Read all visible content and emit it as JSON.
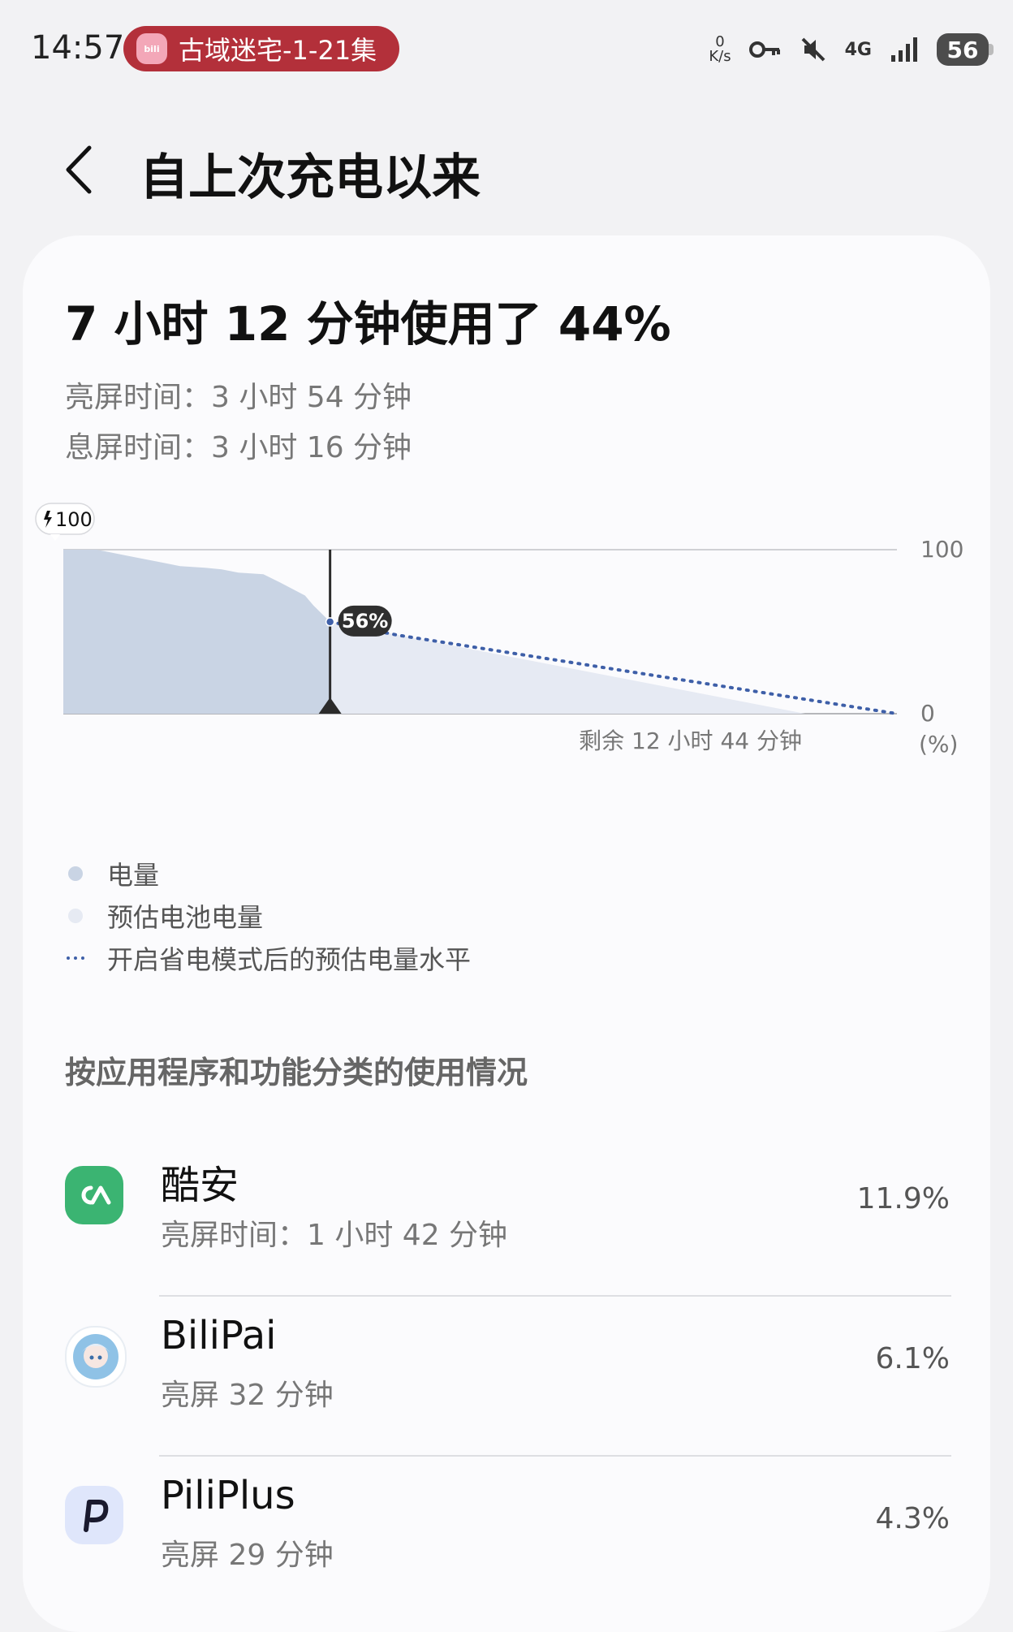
{
  "status_bar": {
    "time": "14:57",
    "media_title": "古域迷宅-1-21集",
    "media_app_icon": "bilipai-app-icon",
    "network_speed_value": "0",
    "network_speed_unit": "K/s",
    "network_type": "4G",
    "battery_level": "56",
    "icons": [
      "key-icon",
      "mute-icon",
      "4g-data-icon",
      "signal-icon",
      "battery-icon"
    ]
  },
  "header": {
    "title": "自上次充电以来",
    "back_icon": "chevron-left-icon"
  },
  "summary": {
    "headline": "7 小时 12 分钟使用了 44%",
    "screen_on": "亮屏时间：3 小时 54 分钟",
    "screen_off": "息屏时间：3 小时 16 分钟"
  },
  "chart_data": {
    "type": "area",
    "start_badge": "100",
    "start_badge_icon": "charging-bolt-icon",
    "current_label": "56%",
    "remaining_label": "剩余 12 小时 44 分钟",
    "y_tick_top": "100",
    "y_tick_bottom": "0",
    "y_unit": "(%)",
    "ylim": [
      0,
      100
    ],
    "elapsed_fraction": 0.32,
    "actual_series": {
      "name": "电量",
      "color": "#c9d4e4",
      "points": [
        [
          0.0,
          100
        ],
        [
          0.04,
          100
        ],
        [
          0.08,
          96
        ],
        [
          0.12,
          92
        ],
        [
          0.14,
          90
        ],
        [
          0.17,
          89
        ],
        [
          0.19,
          88
        ],
        [
          0.21,
          86
        ],
        [
          0.24,
          85
        ],
        [
          0.26,
          80
        ],
        [
          0.29,
          72
        ],
        [
          0.3,
          66
        ],
        [
          0.32,
          56
        ]
      ]
    },
    "estimated_series": {
      "name": "预估电池电量",
      "color": "#e6eaf3",
      "points": [
        [
          0.32,
          56
        ],
        [
          0.89,
          0
        ]
      ]
    },
    "saving_series": {
      "name": "开启省电模式后的预估电量水平",
      "color": "#3e5fa8",
      "points": [
        [
          0.32,
          56
        ],
        [
          0.4,
          48
        ],
        [
          1.0,
          0
        ]
      ]
    }
  },
  "legend": [
    {
      "label": "电量",
      "color": "#c9d4e4",
      "marker": "dot"
    },
    {
      "label": "预估电池电量",
      "color": "#e6eaf3",
      "marker": "dot"
    },
    {
      "label": "开启省电模式后的预估电量水平",
      "color": "#3e5fa8",
      "marker": "dotted"
    }
  ],
  "section": {
    "title": "按应用程序和功能分类的使用情况"
  },
  "apps": [
    {
      "name": "酷安",
      "detail": "亮屏时间：1 小时 42 分钟",
      "percent": "11.9%",
      "icon": "coolapk-icon",
      "icon_color": "#3bb472"
    },
    {
      "name": "BiliPai",
      "detail": "亮屏 32 分钟",
      "percent": "6.1%",
      "icon": "bilipai-icon",
      "icon_color": "#8fc2e6"
    },
    {
      "name": "PiliPlus",
      "detail": "亮屏 29 分钟",
      "percent": "4.3%",
      "icon": "piliplus-icon",
      "icon_color": "#dfe6fb"
    }
  ]
}
